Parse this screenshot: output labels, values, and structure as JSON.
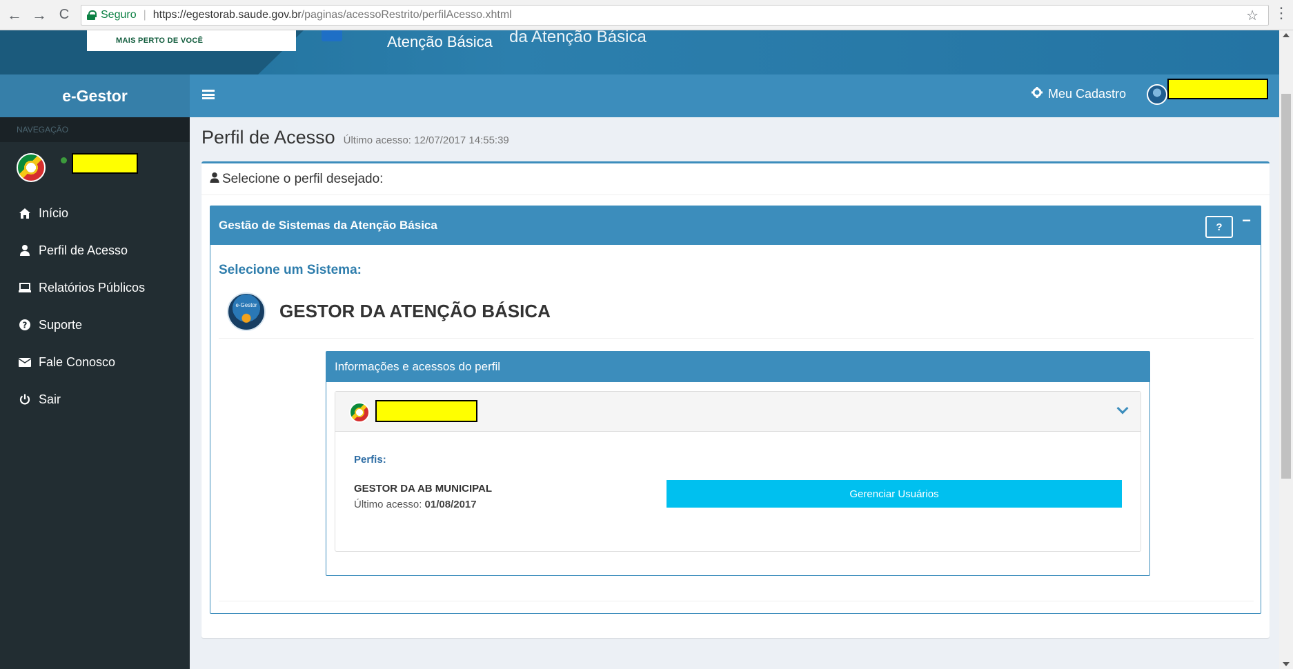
{
  "browser": {
    "secure_label": "Seguro",
    "url_host": "https://egestorab.saude.gov.br",
    "url_path": "/paginas/acessoRestrito/perfilAcesso.xhtml"
  },
  "banner": {
    "logo_text": "MAIS PERTO DE VOCÊ",
    "subtitle": "Atenção Básica",
    "subtitle2": "da Atenção Básica"
  },
  "sidebar": {
    "brand": "e-Gestor",
    "nav_header": "NAVEGAÇÃO",
    "items": [
      {
        "label": "Início",
        "icon": "home-icon"
      },
      {
        "label": "Perfil de Acesso",
        "icon": "user-icon"
      },
      {
        "label": "Relatórios Públicos",
        "icon": "laptop-icon"
      },
      {
        "label": "Suporte",
        "icon": "question-circle-icon"
      },
      {
        "label": "Fale Conosco",
        "icon": "envelope-icon"
      },
      {
        "label": "Sair",
        "icon": "power-icon"
      }
    ]
  },
  "topbar": {
    "meu_cadastro": "Meu Cadastro"
  },
  "content": {
    "page_title": "Perfil de Acesso",
    "last_access": "Último acesso: 12/07/2017 14:55:39",
    "box_title": "Selecione o perfil desejado:",
    "panel_title": "Gestão de Sistemas da Atenção Básica",
    "help_label": "?",
    "collapse_label": "−",
    "select_system": "Selecione um Sistema:",
    "system_logo_text": "e-Gestor",
    "system_name": "GESTOR DA ATENÇÃO BÁSICA",
    "info_title": "Informações e acessos do perfil",
    "perfis_label": "Perfis:",
    "profile_name": "GESTOR DA AB MUNICIPAL",
    "profile_last_prefix": "Último acesso: ",
    "profile_last_date": "01/08/2017",
    "manage_button": "Gerenciar Usuários"
  },
  "colors": {
    "primary": "#3c8dbc",
    "sidebar_bg": "#222d32",
    "manage_button": "#00c0ef",
    "redaction": "#ffff00"
  }
}
